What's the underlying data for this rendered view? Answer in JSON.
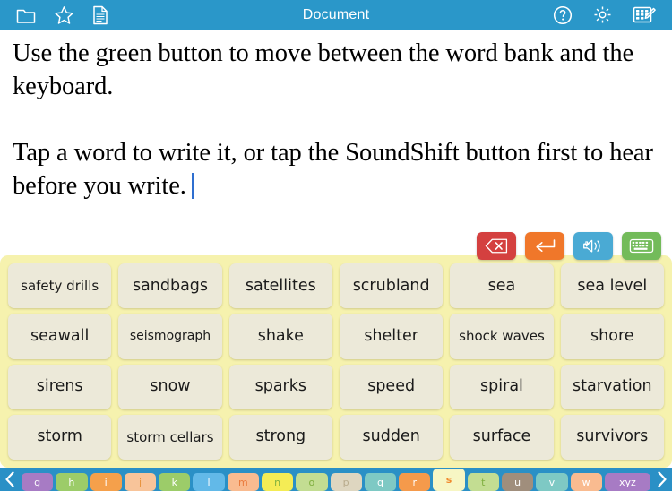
{
  "topbar": {
    "title": "Document",
    "background": "#2a97c9",
    "left_icons": [
      {
        "name": "folder-icon",
        "label": "Open folder"
      },
      {
        "name": "star-icon",
        "label": "Favorites"
      },
      {
        "name": "document-icon",
        "label": "Document"
      }
    ],
    "right_icons": [
      {
        "name": "help-icon",
        "label": "Help"
      },
      {
        "name": "gear-icon",
        "label": "Settings"
      },
      {
        "name": "edit-grid-icon",
        "label": "Edit grid"
      }
    ]
  },
  "document": {
    "paragraph1": "Use the green button to move between the word bank and the keyboard.",
    "paragraph2": "Tap a word to write it, or tap the SoundShift button first to hear before you write.",
    "caret_color": "#2f6fd0"
  },
  "actions": [
    {
      "name": "backspace-button",
      "label": "Backspace",
      "color": "#d4403f"
    },
    {
      "name": "return-button",
      "label": "Return",
      "color": "#f0772a"
    },
    {
      "name": "soundshift-button",
      "label": "SoundShift",
      "color": "#4aaad4"
    },
    {
      "name": "keyboard-toggle-button",
      "label": "Keyboard",
      "color": "#73bb5a"
    }
  ],
  "wordbank": {
    "panel_color": "#f6f2ae",
    "tile_color": "#ece9d9",
    "rows": [
      [
        "safety drills",
        "sandbags",
        "satellites",
        "scrubland",
        "sea",
        "sea level"
      ],
      [
        "seawall",
        "seismograph",
        "shake",
        "shelter",
        "shock waves",
        "shore"
      ],
      [
        "sirens",
        "snow",
        "sparks",
        "speed",
        "spiral",
        "starvation"
      ],
      [
        "storm",
        "storm cellars",
        "strong",
        "sudden",
        "surface",
        "survivors"
      ]
    ]
  },
  "alphabet": {
    "bar_color": "#2a90c6",
    "prev_label": "‹",
    "next_label": "›",
    "keys": [
      {
        "letter": "g",
        "bg": "#a77bc4",
        "fg": "#ffffff",
        "selected": false
      },
      {
        "letter": "h",
        "bg": "#9ccc69",
        "fg": "#ffffff",
        "selected": false
      },
      {
        "letter": "i",
        "bg": "#f5a04b",
        "fg": "#ffffff",
        "selected": false
      },
      {
        "letter": "j",
        "bg": "#f8c49a",
        "fg": "#e8933c",
        "selected": false
      },
      {
        "letter": "k",
        "bg": "#9ccc69",
        "fg": "#ffffff",
        "selected": false
      },
      {
        "letter": "l",
        "bg": "#62b9e8",
        "fg": "#ffffff",
        "selected": false
      },
      {
        "letter": "m",
        "bg": "#f9bb90",
        "fg": "#ea7a3c",
        "selected": false
      },
      {
        "letter": "n",
        "bg": "#f4ec55",
        "fg": "#7fb23e",
        "selected": false
      },
      {
        "letter": "o",
        "bg": "#c3dd92",
        "fg": "#7fae3e",
        "selected": false
      },
      {
        "letter": "p",
        "bg": "#ded6c0",
        "fg": "#b8ab8c",
        "selected": false
      },
      {
        "letter": "q",
        "bg": "#7ec9c4",
        "fg": "#ffffff",
        "selected": false
      },
      {
        "letter": "r",
        "bg": "#f59a4b",
        "fg": "#ffffff",
        "selected": false
      },
      {
        "letter": "s",
        "bg": "#f7f6c4",
        "fg": "#f08a2e",
        "selected": true
      },
      {
        "letter": "t",
        "bg": "#c3dd92",
        "fg": "#7fae3e",
        "selected": false
      },
      {
        "letter": "u",
        "bg": "#a08e7c",
        "fg": "#ffffff",
        "selected": false
      },
      {
        "letter": "v",
        "bg": "#7ec9c4",
        "fg": "#ffffff",
        "selected": false
      },
      {
        "letter": "w",
        "bg": "#f9bb90",
        "fg": "#ffffff",
        "selected": false
      },
      {
        "letter": "xyz",
        "bg": "#a77bc4",
        "fg": "#ffffff",
        "selected": false
      }
    ]
  }
}
